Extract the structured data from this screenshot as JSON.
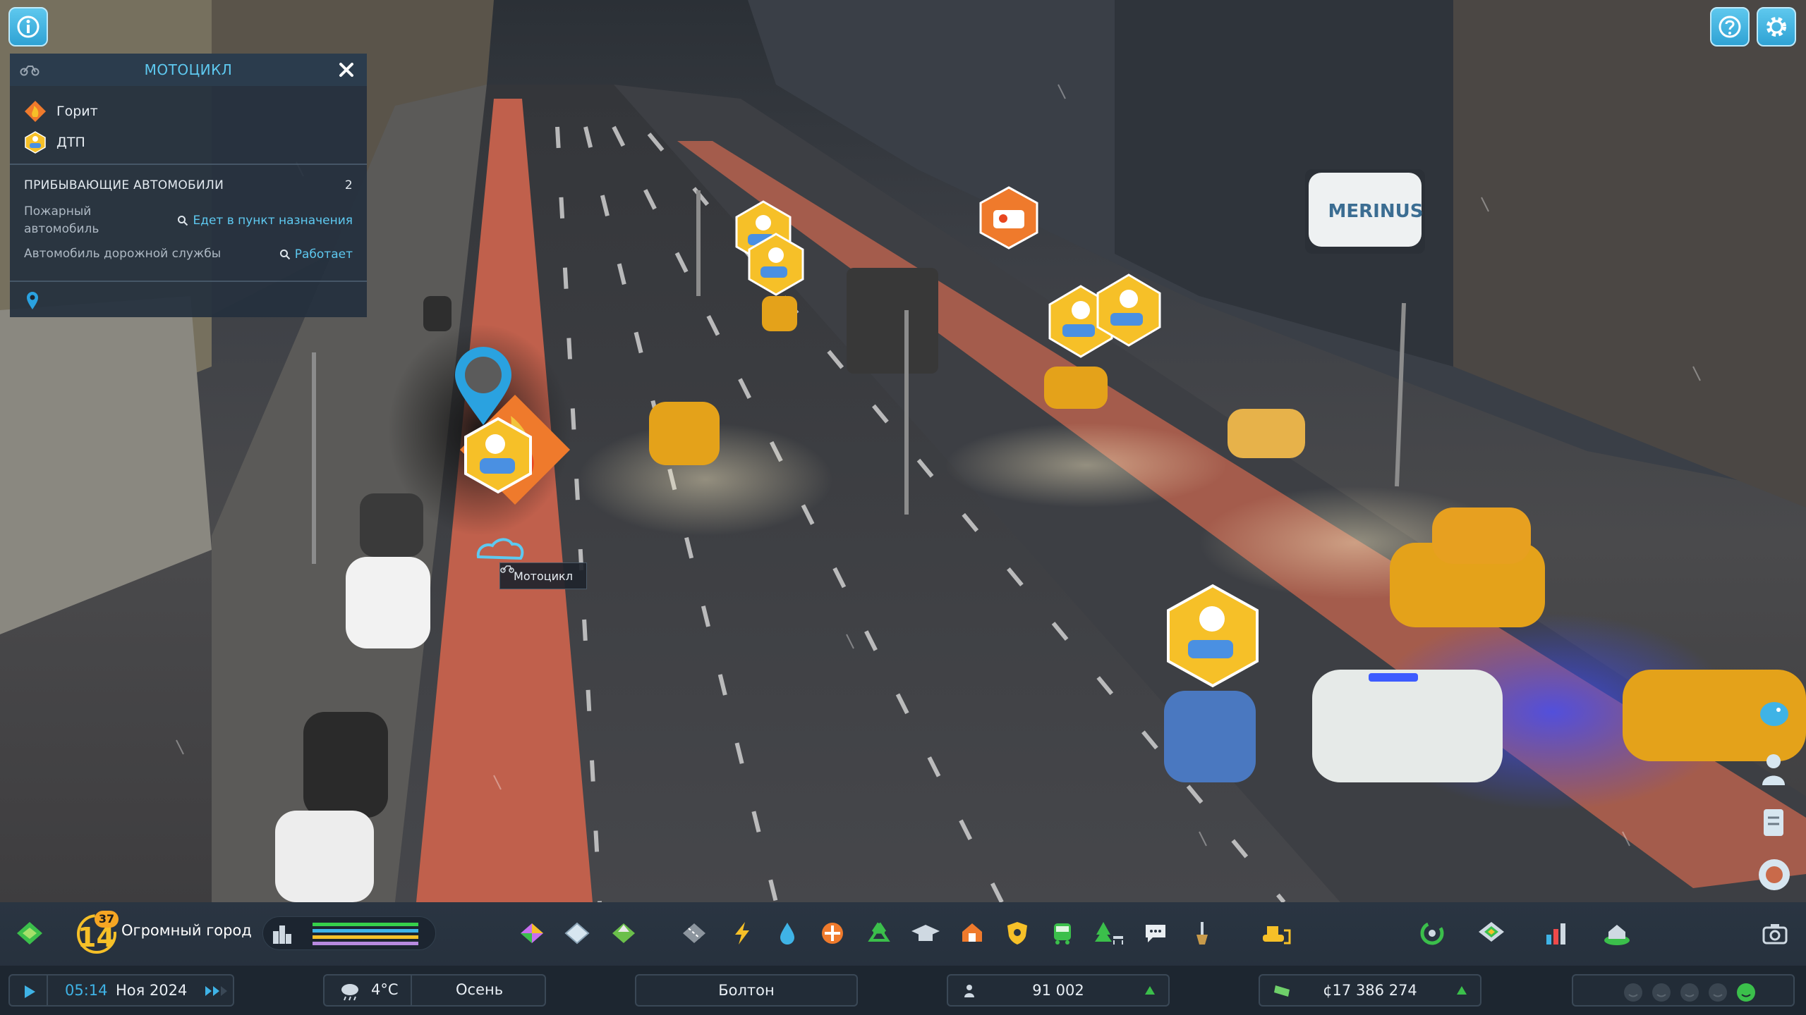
{
  "info_panel": {
    "title": "МОТОЦИКЛ",
    "statuses": [
      {
        "label": "Горит",
        "icon": "fire-icon"
      },
      {
        "label": "ДТП",
        "icon": "car-accident-icon"
      }
    ],
    "arrivals_header": "ПРИБЫВАЮЩИЕ АВТОМОБИЛИ",
    "arrivals_count": "2",
    "arrivals": [
      {
        "vehicle": "Пожарный автомобиль",
        "status": "Едет в пункт назначения"
      },
      {
        "vehicle": "Автомобиль дорожной службы",
        "status": "Работает"
      }
    ]
  },
  "tooltip": {
    "label": "Мотоцикл"
  },
  "city": {
    "name": "Огромный город",
    "level": "14",
    "level_sub": "37"
  },
  "time": {
    "clock": "05:14",
    "date": "Ноя 2024"
  },
  "weather": {
    "temperature": "4°C",
    "season": "Осень"
  },
  "district": {
    "name": "Болтон"
  },
  "population": {
    "value": "91 002"
  },
  "money": {
    "value": "¢17 386 274"
  },
  "scene_text": {
    "store_sign": "MERINUS"
  },
  "colors": {
    "accent": "#5ec9f0",
    "bike_lane": "#c0604c",
    "warning_yellow": "#f6c028",
    "fire_orange": "#ef7a2c"
  },
  "toolbar_icons": [
    "zones-icon",
    "areas-icon",
    "terraform-icon",
    "roads-icon",
    "electricity-icon",
    "water-icon",
    "health-icon",
    "garbage-icon",
    "education-icon",
    "fire-station-icon",
    "police-icon",
    "transport-icon",
    "parks-icon",
    "communications-icon",
    "landscaping-icon",
    "bulldozer-icon",
    "progression-icon",
    "map-tiles-icon",
    "statistics-icon",
    "economy-icon",
    "photo-mode-icon"
  ],
  "happiness_levels": 5,
  "happiness_current": 5
}
